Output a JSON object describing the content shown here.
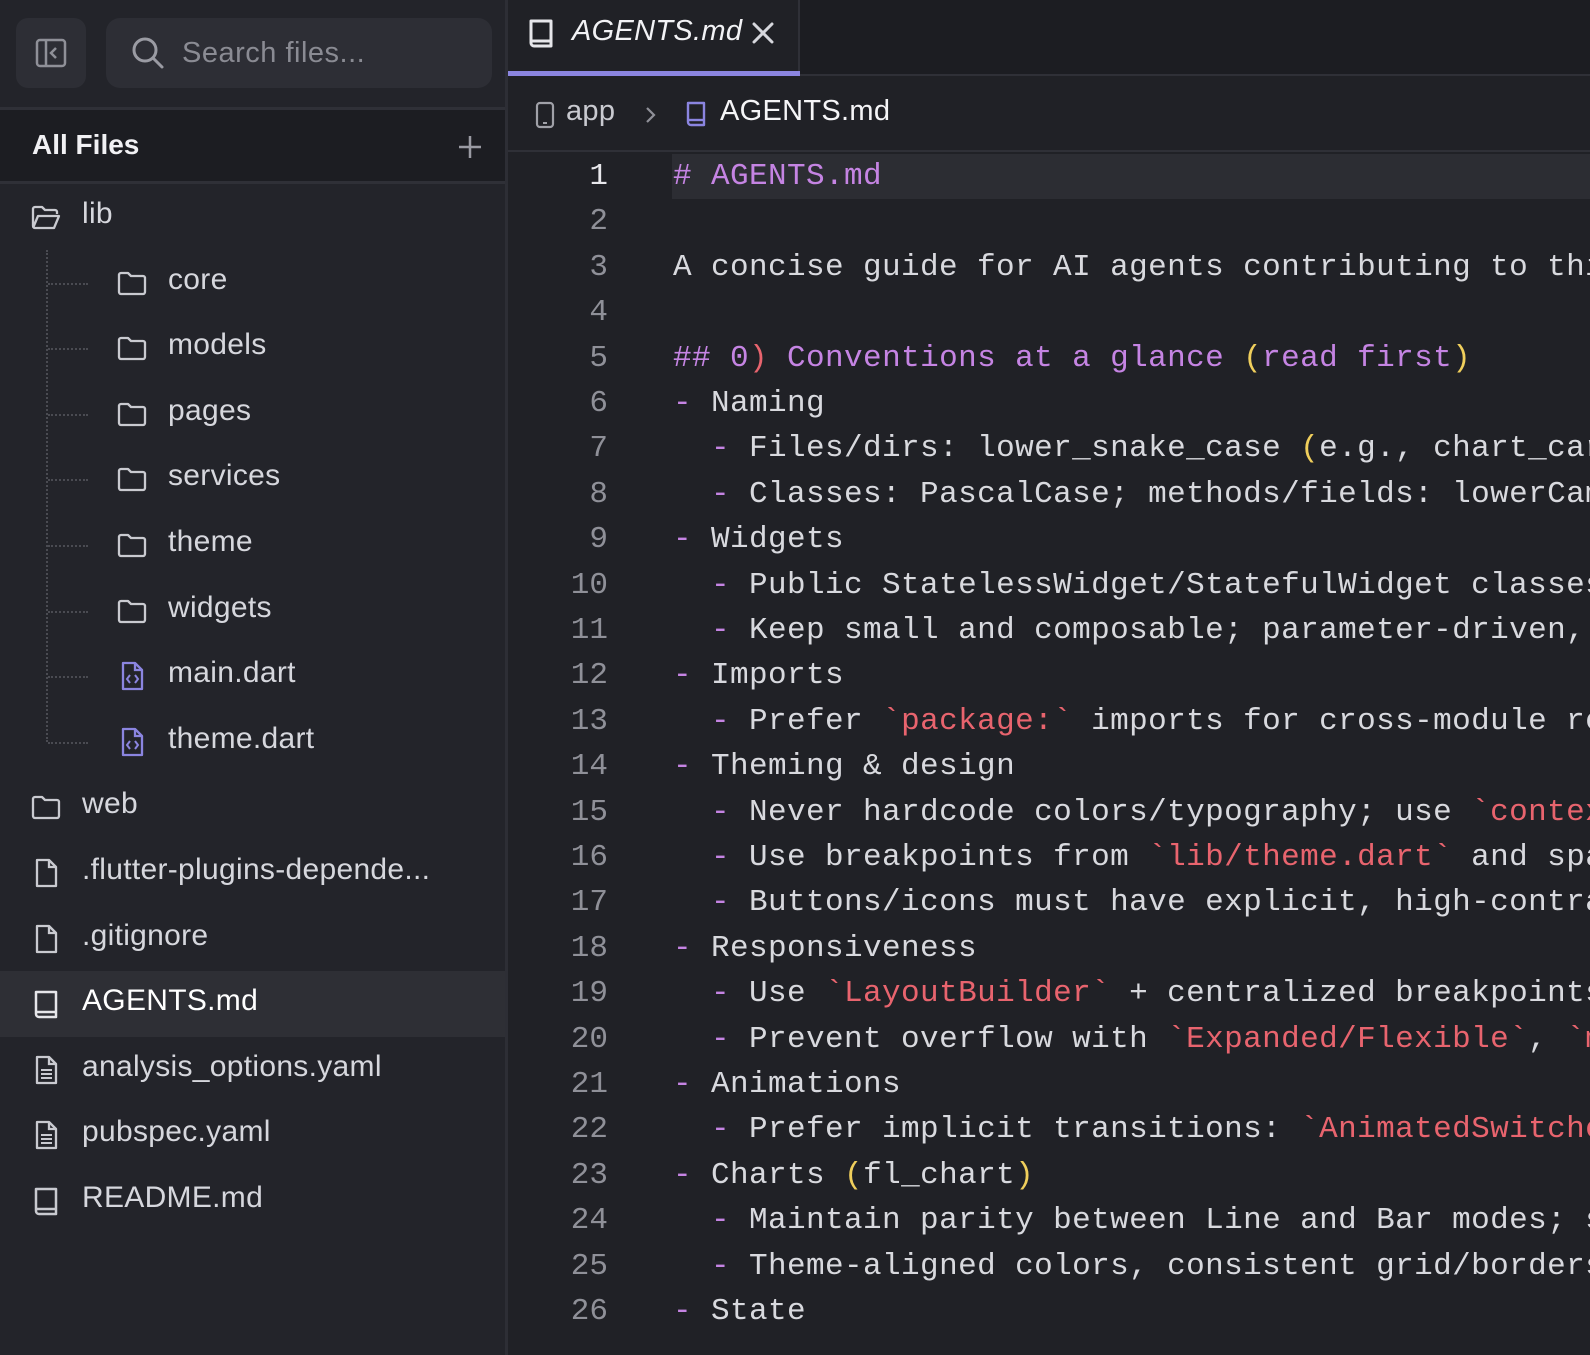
{
  "sidebar": {
    "search_placeholder": "Search files...",
    "header_title": "All Files",
    "tree": [
      {
        "label": "lib",
        "icon": "folder-open-icon",
        "level": 0
      },
      {
        "label": "core",
        "icon": "folder-icon",
        "level": 1
      },
      {
        "label": "models",
        "icon": "folder-icon",
        "level": 1
      },
      {
        "label": "pages",
        "icon": "folder-icon",
        "level": 1
      },
      {
        "label": "services",
        "icon": "folder-icon",
        "level": 1
      },
      {
        "label": "theme",
        "icon": "folder-icon",
        "level": 1
      },
      {
        "label": "widgets",
        "icon": "folder-icon",
        "level": 1
      },
      {
        "label": "main.dart",
        "icon": "code-file-icon",
        "level": 1
      },
      {
        "label": "theme.dart",
        "icon": "code-file-icon",
        "level": 1
      },
      {
        "label": "web",
        "icon": "folder-icon",
        "level": 0
      },
      {
        "label": ".flutter-plugins-depende...",
        "icon": "file-icon",
        "level": 0
      },
      {
        "label": ".gitignore",
        "icon": "file-icon",
        "level": 0
      },
      {
        "label": "AGENTS.md",
        "icon": "book-icon",
        "level": 0,
        "selected": true
      },
      {
        "label": "analysis_options.yaml",
        "icon": "text-file-icon",
        "level": 0
      },
      {
        "label": "pubspec.yaml",
        "icon": "text-file-icon",
        "level": 0
      },
      {
        "label": "README.md",
        "icon": "book-icon",
        "level": 0
      }
    ]
  },
  "tab": {
    "label": "AGENTS.md",
    "accent_color": "#8b85e0"
  },
  "breadcrumb": {
    "parent": "app",
    "current": "AGENTS.md"
  },
  "editor": {
    "active_line": 1,
    "lines": [
      {
        "n": "1",
        "segs": [
          [
            "h",
            "# AGENTS.md"
          ]
        ]
      },
      {
        "n": "2",
        "segs": []
      },
      {
        "n": "3",
        "segs": [
          [
            "t",
            "A concise guide for AI agents contributing to thi"
          ]
        ]
      },
      {
        "n": "4",
        "segs": []
      },
      {
        "n": "5",
        "segs": [
          [
            "pk",
            "## "
          ],
          [
            "h",
            "0"
          ],
          [
            "rp",
            ")"
          ],
          [
            "h",
            " Conventions at a glance "
          ],
          [
            "hy",
            "("
          ],
          [
            "h",
            "read first"
          ],
          [
            "hy",
            ")"
          ]
        ]
      },
      {
        "n": "6",
        "segs": [
          [
            "pk",
            "-"
          ],
          [
            "t",
            " Naming"
          ]
        ]
      },
      {
        "n": "7",
        "segs": [
          [
            "t",
            "  "
          ],
          [
            "pk",
            "-"
          ],
          [
            "t",
            " Files/dirs: lower_snake_case "
          ],
          [
            "hy",
            "("
          ],
          [
            "t",
            "e.g., chart_car"
          ]
        ]
      },
      {
        "n": "8",
        "segs": [
          [
            "t",
            "  "
          ],
          [
            "pk",
            "-"
          ],
          [
            "t",
            " Classes: PascalCase; methods/fields: lowerCame"
          ]
        ]
      },
      {
        "n": "9",
        "segs": [
          [
            "pk",
            "-"
          ],
          [
            "t",
            " Widgets"
          ]
        ]
      },
      {
        "n": "10",
        "segs": [
          [
            "t",
            "  "
          ],
          [
            "pk",
            "-"
          ],
          [
            "t",
            " Public StatelessWidget/StatefulWidget classes"
          ]
        ]
      },
      {
        "n": "11",
        "segs": [
          [
            "t",
            "  "
          ],
          [
            "pk",
            "-"
          ],
          [
            "t",
            " Keep small and composable; parameter-driven,"
          ]
        ]
      },
      {
        "n": "12",
        "segs": [
          [
            "pk",
            "-"
          ],
          [
            "t",
            " Imports"
          ]
        ]
      },
      {
        "n": "13",
        "segs": [
          [
            "t",
            "  "
          ],
          [
            "pk",
            "-"
          ],
          [
            "t",
            " Prefer "
          ],
          [
            "bq",
            "`package:`"
          ],
          [
            "t",
            " imports for cross-module re"
          ]
        ]
      },
      {
        "n": "14",
        "segs": [
          [
            "pk",
            "-"
          ],
          [
            "t",
            " Theming & design"
          ]
        ]
      },
      {
        "n": "15",
        "segs": [
          [
            "t",
            "  "
          ],
          [
            "pk",
            "-"
          ],
          [
            "t",
            " Never hardcode colors/typography; use "
          ],
          [
            "bq",
            "`contex"
          ]
        ]
      },
      {
        "n": "16",
        "segs": [
          [
            "t",
            "  "
          ],
          [
            "pk",
            "-"
          ],
          [
            "t",
            " Use breakpoints from "
          ],
          [
            "bq",
            "`lib/theme.dart`"
          ],
          [
            "t",
            " and spa"
          ]
        ]
      },
      {
        "n": "17",
        "segs": [
          [
            "t",
            "  "
          ],
          [
            "pk",
            "-"
          ],
          [
            "t",
            " Buttons/icons must have explicit, high-contra"
          ]
        ]
      },
      {
        "n": "18",
        "segs": [
          [
            "pk",
            "-"
          ],
          [
            "t",
            " Responsiveness"
          ]
        ]
      },
      {
        "n": "19",
        "segs": [
          [
            "t",
            "  "
          ],
          [
            "pk",
            "-"
          ],
          [
            "t",
            " Use "
          ],
          [
            "bq",
            "`LayoutBuilder`"
          ],
          [
            "t",
            " + centralized breakpoints"
          ]
        ]
      },
      {
        "n": "20",
        "segs": [
          [
            "t",
            "  "
          ],
          [
            "pk",
            "-"
          ],
          [
            "t",
            " Prevent overflow with "
          ],
          [
            "bq",
            "`Expanded/Flexible`"
          ],
          [
            "t",
            ", "
          ],
          [
            "bq",
            "`ma"
          ]
        ]
      },
      {
        "n": "21",
        "segs": [
          [
            "pk",
            "-"
          ],
          [
            "t",
            " Animations"
          ]
        ]
      },
      {
        "n": "22",
        "segs": [
          [
            "t",
            "  "
          ],
          [
            "pk",
            "-"
          ],
          [
            "t",
            " Prefer implicit transitions: "
          ],
          [
            "bq",
            "`AnimatedSwitche"
          ]
        ]
      },
      {
        "n": "23",
        "segs": [
          [
            "pk",
            "-"
          ],
          [
            "t",
            " Charts "
          ],
          [
            "hy",
            "("
          ],
          [
            "t",
            "fl_chart"
          ],
          [
            "hy",
            ")"
          ]
        ]
      },
      {
        "n": "24",
        "segs": [
          [
            "t",
            "  "
          ],
          [
            "pk",
            "-"
          ],
          [
            "t",
            " Maintain parity between Line and Bar modes; s"
          ]
        ]
      },
      {
        "n": "25",
        "segs": [
          [
            "t",
            "  "
          ],
          [
            "pk",
            "-"
          ],
          [
            "t",
            " Theme-aligned colors, consistent grid/borders"
          ]
        ]
      },
      {
        "n": "26",
        "segs": [
          [
            "pk",
            "-"
          ],
          [
            "t",
            " State"
          ]
        ]
      }
    ]
  }
}
